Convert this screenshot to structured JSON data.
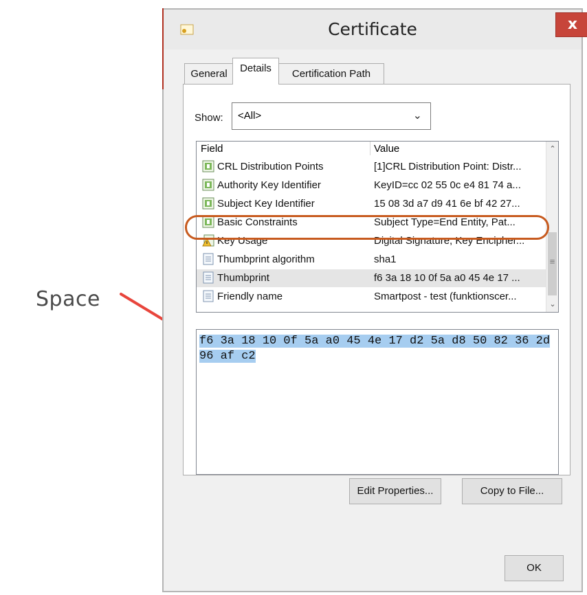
{
  "annotation": {
    "label": "Space"
  },
  "dialog": {
    "title": "Certificate",
    "close_label": "x",
    "tabs": [
      {
        "label": "General"
      },
      {
        "label": "Details",
        "active": true
      },
      {
        "label": "Certification Path"
      }
    ],
    "show": {
      "label": "Show:",
      "selected": "<All>"
    },
    "list": {
      "headers": {
        "field": "Field",
        "value": "Value"
      },
      "rows": [
        {
          "field": "CRL Distribution Points",
          "value": "[1]CRL Distribution Point: Distr...",
          "icon": "extension-icon"
        },
        {
          "field": "Authority Key Identifier",
          "value": "KeyID=cc 02 55 0c e4 81 74 a...",
          "icon": "extension-icon"
        },
        {
          "field": "Subject Key Identifier",
          "value": "15 08 3d a7 d9 41 6e bf 42 27...",
          "icon": "extension-icon"
        },
        {
          "field": "Basic Constraints",
          "value": "Subject Type=End Entity, Pat...",
          "icon": "extension-icon"
        },
        {
          "field": "Key Usage",
          "value": "Digital Signature, Key Encipher...",
          "icon": "warning-extension-icon"
        },
        {
          "field": "Thumbprint algorithm",
          "value": "sha1",
          "icon": "property-icon"
        },
        {
          "field": "Thumbprint",
          "value": "f6 3a 18 10 0f 5a a0 45 4e 17 ...",
          "icon": "property-icon",
          "selected": true
        },
        {
          "field": "Friendly name",
          "value": "Smartpost - test (funktionscer...",
          "icon": "property-icon"
        }
      ]
    },
    "value_text": "f6 3a 18 10 0f 5a a0 45 4e 17 d2 5a d8 50 82 36 2d 96 af c2",
    "buttons": {
      "edit_properties": "Edit Properties...",
      "copy_to_file": "Copy to File...",
      "ok": "OK"
    },
    "colors": {
      "highlight_ring": "#c75a1e",
      "selection": "#a6cdf0",
      "close": "#c7453a",
      "arrow": "#e8453c"
    }
  }
}
